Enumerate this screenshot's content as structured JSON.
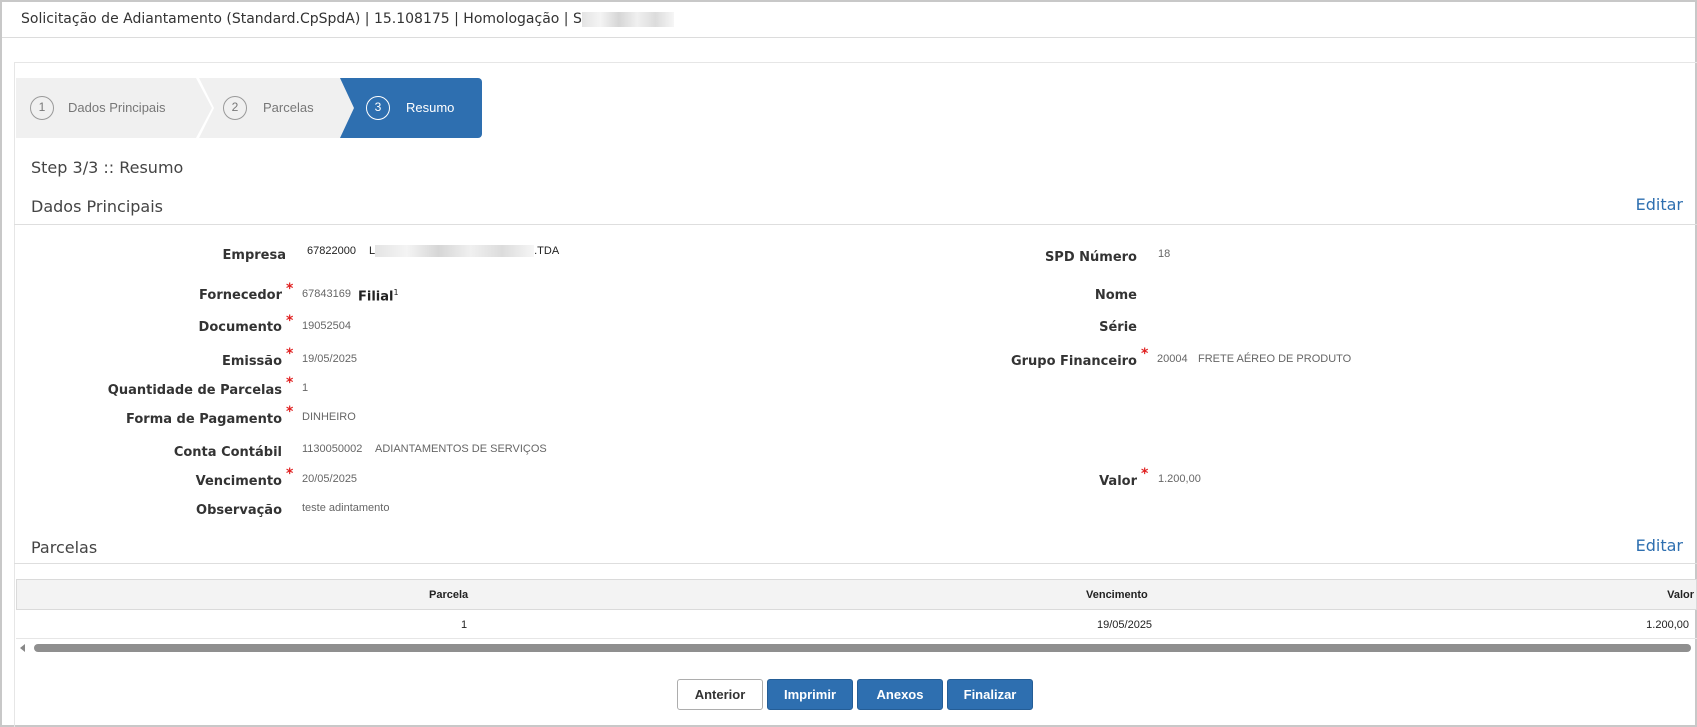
{
  "window": {
    "title": "Solicitação de Adiantamento (Standard.CpSpdA) | 15.108175 | Homologação | S"
  },
  "steps": [
    {
      "number": "1",
      "label": "Dados Principais"
    },
    {
      "number": "2",
      "label": "Parcelas"
    },
    {
      "number": "3",
      "label": "Resumo"
    }
  ],
  "step_title": "Step 3/3 :: Resumo",
  "sections": {
    "dados": {
      "title": "Dados Principais",
      "edit_label": "Editar"
    },
    "parcelas": {
      "title": "Parcelas",
      "edit_label": "Editar"
    }
  },
  "fields": {
    "empresa": {
      "label": "Empresa",
      "code": "67822000",
      "name_start": "L",
      "name_end": ".TDA"
    },
    "fornecedor": {
      "label": "Fornecedor",
      "code": "67843169",
      "extra": "Filial",
      "sup": "1"
    },
    "documento": {
      "label": "Documento",
      "value": "19052504"
    },
    "emissao": {
      "label": "Emissão",
      "value": "19/05/2025"
    },
    "quantidade": {
      "label": "Quantidade de Parcelas",
      "value": "1"
    },
    "forma_pagamento": {
      "label": "Forma de Pagamento",
      "value": "DINHEIRO"
    },
    "conta_contabil": {
      "label": "Conta Contábil",
      "code": "1130050002",
      "desc": "ADIANTAMENTOS DE SERVIÇOS"
    },
    "vencimento": {
      "label": "Vencimento",
      "value": "20/05/2025"
    },
    "observacao": {
      "label": "Observação",
      "value": "teste adintamento"
    },
    "spd_numero": {
      "label": "SPD Número",
      "value": "18"
    },
    "nome": {
      "label": "Nome"
    },
    "serie": {
      "label": "Série"
    },
    "grupo_financeiro": {
      "label": "Grupo Financeiro",
      "code": "20004",
      "desc": "FRETE AÉREO DE PRODUTO"
    },
    "valor": {
      "label": "Valor",
      "value": "1.200,00"
    }
  },
  "required_mark": "*",
  "table": {
    "headers": {
      "parcela": "Parcela",
      "vencimento": "Vencimento",
      "valor": "Valor"
    },
    "rows": [
      {
        "parcela": "1",
        "vencimento": "19/05/2025",
        "valor": "1.200,00"
      }
    ]
  },
  "buttons": {
    "anterior": "Anterior",
    "imprimir": "Imprimir",
    "anexos": "Anexos",
    "finalizar": "Finalizar"
  },
  "colors": {
    "accent": "#2e6fb0",
    "required": "#e02020"
  }
}
